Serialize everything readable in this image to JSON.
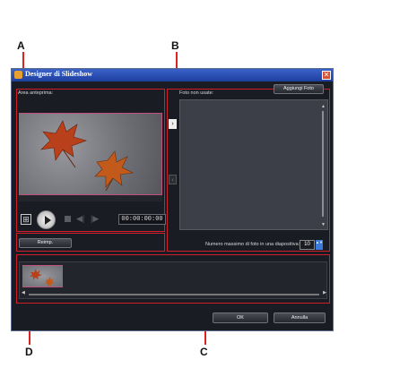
{
  "callouts": {
    "a": "A",
    "b": "B",
    "c": "C",
    "d": "D"
  },
  "window": {
    "title": "Designer di Slideshow",
    "close_glyph": "✕"
  },
  "preview": {
    "label": "Area anteprima:",
    "timecode": "00:00:00:00",
    "reset_label": "Reimp."
  },
  "photos": {
    "add_label": "Aggiungi Foto",
    "unused_label": "Foto non usate:",
    "max_label": "Numero massimo di foto in una diapositiva:",
    "max_value": "10"
  },
  "footer": {
    "ok_label": "OK",
    "cancel_label": "Annulla"
  },
  "icons": {
    "grid": "⊞",
    "prev": "◀|",
    "next": "|▶",
    "arrow_right": "›",
    "arrow_left": "‹",
    "up": "▲",
    "down": "▼",
    "left": "◀",
    "right": "▶",
    "spin": "▲▼"
  },
  "colors": {
    "callout_border": "#d01e2a",
    "window_bg": "#1a1c24",
    "titlebar": "#2a50b8",
    "accent_blue": "#3a7ad8"
  }
}
